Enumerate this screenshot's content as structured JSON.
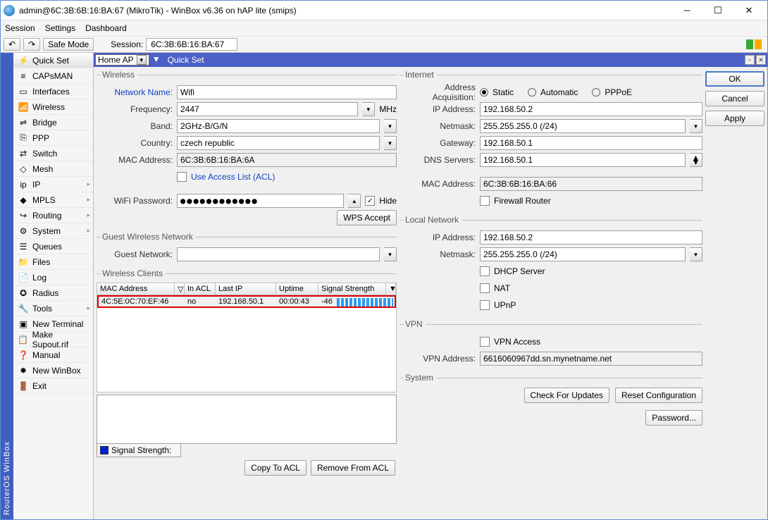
{
  "window": {
    "title": "admin@6C:3B:6B:16:BA:67 (MikroTik) - WinBox v6.36 on hAP lite (smips)"
  },
  "menu": {
    "session": "Session",
    "settings": "Settings",
    "dashboard": "Dashboard"
  },
  "sessionbar": {
    "safe_mode": "Safe Mode",
    "session_label": "Session:",
    "session_value": "6C:3B:6B:16:BA:67"
  },
  "side_title": "RouterOS WinBox",
  "sidebar": [
    {
      "label": "Quick Set",
      "icon": "⚡"
    },
    {
      "label": "CAPsMAN",
      "icon": "≡"
    },
    {
      "label": "Interfaces",
      "icon": "▭"
    },
    {
      "label": "Wireless",
      "icon": "📶"
    },
    {
      "label": "Bridge",
      "icon": "⇌"
    },
    {
      "label": "PPP",
      "icon": "⎘"
    },
    {
      "label": "Switch",
      "icon": "⇄"
    },
    {
      "label": "Mesh",
      "icon": "◇"
    },
    {
      "label": "IP",
      "icon": "ip",
      "sub": true
    },
    {
      "label": "MPLS",
      "icon": "◆",
      "sub": true
    },
    {
      "label": "Routing",
      "icon": "↪",
      "sub": true
    },
    {
      "label": "System",
      "icon": "⚙",
      "sub": true
    },
    {
      "label": "Queues",
      "icon": "☰"
    },
    {
      "label": "Files",
      "icon": "📁"
    },
    {
      "label": "Log",
      "icon": "📄"
    },
    {
      "label": "Radius",
      "icon": "✪"
    },
    {
      "label": "Tools",
      "icon": "🔧",
      "sub": true
    },
    {
      "label": "New Terminal",
      "icon": "▣"
    },
    {
      "label": "Make Supout.rif",
      "icon": "📋"
    },
    {
      "label": "Manual",
      "icon": "❓"
    },
    {
      "label": "New WinBox",
      "icon": "✸"
    },
    {
      "label": "Exit",
      "icon": "🚪"
    }
  ],
  "dock": {
    "mode": "Home AP",
    "title": "Quick Set"
  },
  "wireless": {
    "legend": "Wireless",
    "network_name_label": "Network Name:",
    "network_name": "Wifi",
    "frequency_label": "Frequency:",
    "frequency": "2447",
    "mhz": "MHz",
    "band_label": "Band:",
    "band": "2GHz-B/G/N",
    "country_label": "Country:",
    "country": "czech republic",
    "mac_label": "MAC Address:",
    "mac": "6C:3B:6B:16:BA:6A",
    "acl_label": "Use Access List (ACL)",
    "wifi_pw_label": "WiFi Password:",
    "wifi_pw_mask": "●●●●●●●●●●●●",
    "hide_label": "Hide",
    "wps_accept": "WPS Accept"
  },
  "guest": {
    "legend": "Guest Wireless Network",
    "label": "Guest Network:"
  },
  "clients": {
    "legend": "Wireless Clients",
    "cols": {
      "mac": "MAC Address",
      "inacl": "In ACL",
      "lastip": "Last IP",
      "uptime": "Uptime",
      "signal": "Signal Strength"
    },
    "row": {
      "mac": "4C:5E:0C:70:EF:46",
      "inacl": "no",
      "lastip": "192.168.50.1",
      "uptime": "00:00:43",
      "signal": "-46"
    },
    "graph_legend": "Signal Strength:",
    "copy_acl": "Copy To ACL",
    "remove_acl": "Remove From ACL"
  },
  "internet": {
    "legend": "Internet",
    "acq_label": "Address Acquisition:",
    "acq_static": "Static",
    "acq_auto": "Automatic",
    "acq_pppoe": "PPPoE",
    "ip_label": "IP Address:",
    "ip": "192.168.50.2",
    "netmask_label": "Netmask:",
    "netmask": "255.255.255.0 (/24)",
    "gateway_label": "Gateway:",
    "gateway": "192.168.50.1",
    "dns_label": "DNS Servers:",
    "dns": "192.168.50.1",
    "mac_label": "MAC Address:",
    "mac": "6C:3B:6B:16:BA:66",
    "fw_label": "Firewall Router"
  },
  "local": {
    "legend": "Local Network",
    "ip_label": "IP Address:",
    "ip": "192.168.50.2",
    "netmask_label": "Netmask:",
    "netmask": "255.255.255.0 (/24)",
    "dhcp": "DHCP Server",
    "nat": "NAT",
    "upnp": "UPnP"
  },
  "vpn": {
    "legend": "VPN",
    "access": "VPN Access",
    "addr_label": "VPN Address:",
    "addr": "6616060967dd.sn.mynetname.net"
  },
  "system": {
    "legend": "System",
    "check": "Check For Updates",
    "reset": "Reset Configuration",
    "password": "Password..."
  },
  "buttons": {
    "ok": "OK",
    "cancel": "Cancel",
    "apply": "Apply"
  }
}
